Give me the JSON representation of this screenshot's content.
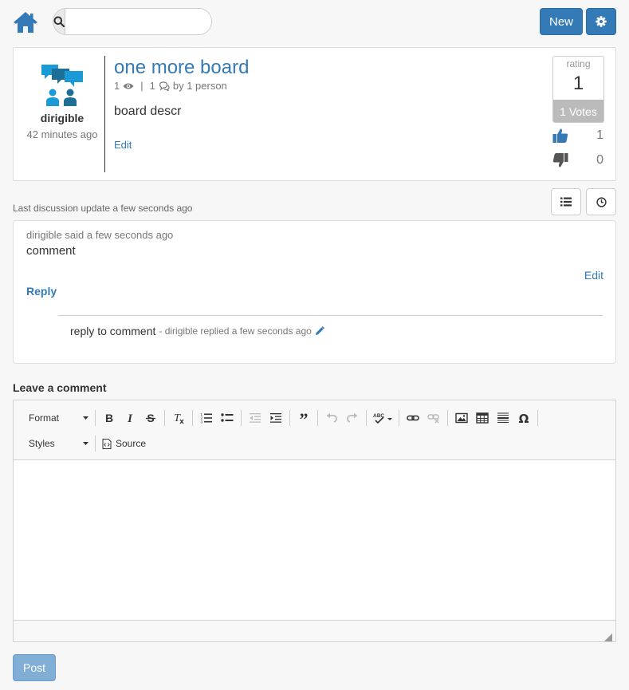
{
  "topbar": {
    "new_label": "New",
    "search_placeholder": ""
  },
  "board": {
    "title": "one more board",
    "views": "1",
    "posts": "1",
    "by_text": "by 1 person",
    "description": "board descr",
    "edit_label": "Edit",
    "author": "dirigible",
    "author_time": "42 minutes ago",
    "rating_label": "rating",
    "rating_value": "1",
    "votes_label": "1 Votes",
    "upvotes": "1",
    "downvotes": "0"
  },
  "discussion": {
    "last_update": "Last discussion update a few seconds ago",
    "comment": {
      "meta": "dirigible said a few seconds ago",
      "text": "comment",
      "edit_label": "Edit",
      "reply_label": "Reply"
    },
    "reply": {
      "text": "reply to comment",
      "meta": "- dirigible replied a few seconds ago"
    }
  },
  "editor": {
    "leave_label": "Leave a comment",
    "format_label": "Format",
    "styles_label": "Styles",
    "source_label": "Source"
  },
  "post_label": "Post",
  "colors": {
    "primary": "#337ab7",
    "primary_disabled": "#80aed5",
    "avatar_blue": "#1a9ad6",
    "avatar_dark": "#1e6f96"
  }
}
